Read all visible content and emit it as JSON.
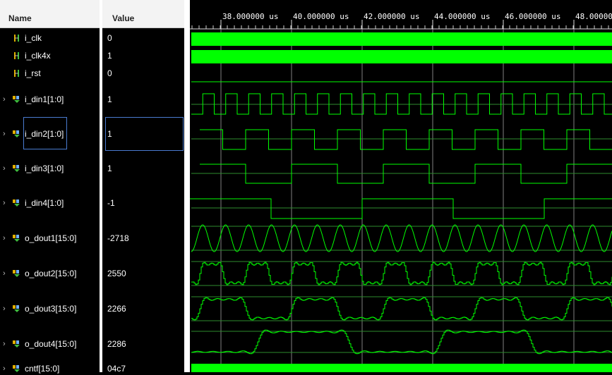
{
  "columns": {
    "name": "Name",
    "value": "Value"
  },
  "timeline": {
    "unit": "us",
    "major_ticks": [
      "38.000000 us",
      "40.000000 us",
      "42.000000 us",
      "44.000000 us",
      "46.000000 us",
      "48.000000 us"
    ]
  },
  "signals": [
    {
      "name": "i_clk",
      "value": "0",
      "kind": "bit",
      "expandable": false,
      "icon": "bit-signal-icon"
    },
    {
      "name": "i_clk4x",
      "value": "1",
      "kind": "bit",
      "expandable": false,
      "icon": "bit-signal-icon"
    },
    {
      "name": "i_rst",
      "value": "0",
      "kind": "bit",
      "expandable": false,
      "icon": "bit-signal-icon"
    },
    {
      "name": "i_din1[1:0]",
      "value": "1",
      "kind": "bus",
      "expandable": true,
      "icon": "bus-signal-icon"
    },
    {
      "name": "i_din2[1:0]",
      "value": "1",
      "kind": "bus",
      "expandable": true,
      "icon": "bus-signal-icon",
      "selected": true
    },
    {
      "name": "i_din3[1:0]",
      "value": "1",
      "kind": "bus",
      "expandable": true,
      "icon": "bus-signal-icon"
    },
    {
      "name": "i_din4[1:0]",
      "value": "-1",
      "kind": "bus",
      "expandable": true,
      "icon": "bus-signal-icon"
    },
    {
      "name": "o_dout1[15:0]",
      "value": "-2718",
      "kind": "analog",
      "expandable": true,
      "icon": "bus-signal-icon"
    },
    {
      "name": "o_dout2[15:0]",
      "value": "2550",
      "kind": "analog",
      "expandable": true,
      "icon": "bus-signal-icon"
    },
    {
      "name": "o_dout3[15:0]",
      "value": "2266",
      "kind": "analog",
      "expandable": true,
      "icon": "bus-signal-icon"
    },
    {
      "name": "o_dout4[15:0]",
      "value": "2286",
      "kind": "analog",
      "expandable": true,
      "icon": "bus-signal-icon"
    },
    {
      "name": "cntf[15:0]",
      "value": "04c7",
      "kind": "bus",
      "expandable": true,
      "icon": "bus-signal-icon"
    }
  ],
  "colors": {
    "wave": "#00ff00",
    "grid": "#808080",
    "background": "#000000",
    "selection": "#4a7bd0"
  }
}
